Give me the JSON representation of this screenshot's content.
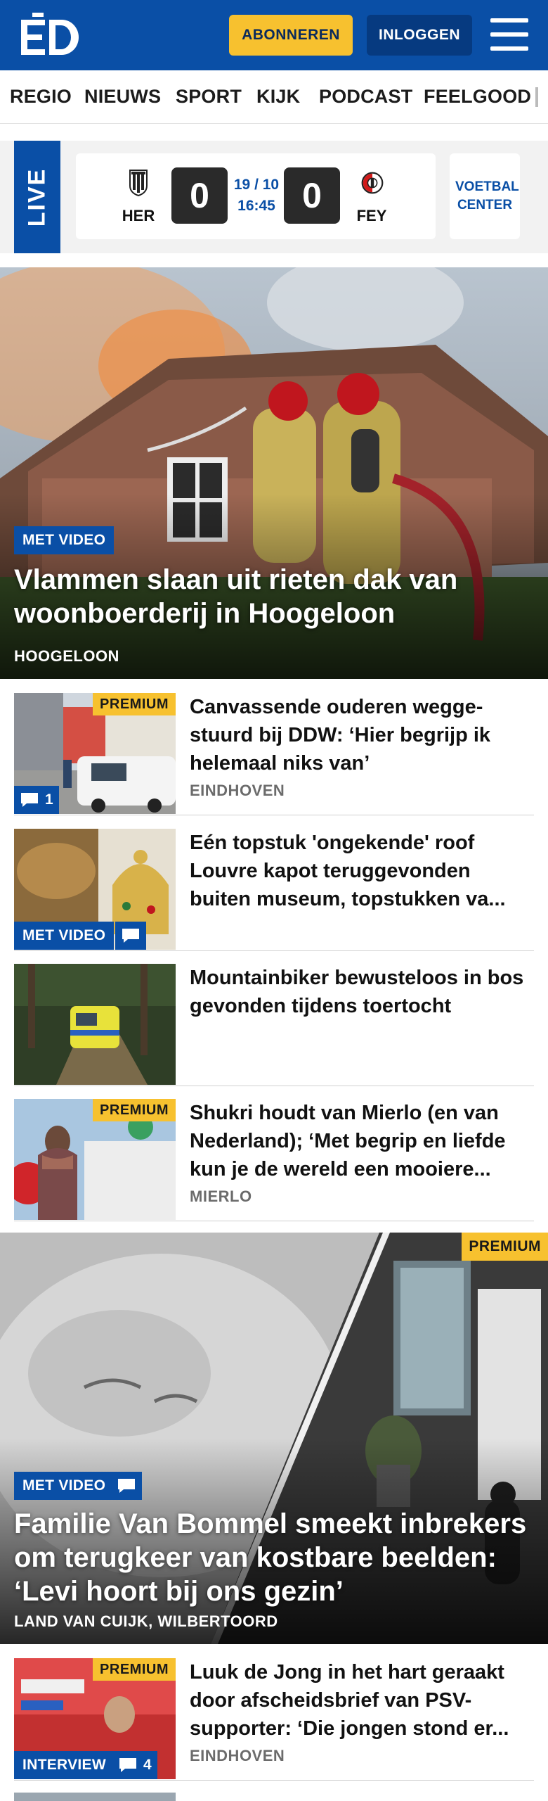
{
  "header": {
    "logo_text": "ED",
    "subscribe_label": "ABONNEREN",
    "login_label": "INLOGGEN",
    "colors": {
      "brand": "#0a4fa6",
      "accent": "#f7c12f",
      "dark": "#063a80"
    }
  },
  "nav": {
    "items": [
      "REGIO",
      "NIEUWS",
      "SPORT",
      "KIJK",
      "PODCAST",
      "FEELGOOD"
    ]
  },
  "live": {
    "label": "LIVE",
    "match": {
      "home": {
        "name": "HER",
        "score": "0"
      },
      "away": {
        "name": "FEY",
        "score": "0"
      },
      "date": "19 / 10",
      "time": "16:45"
    },
    "voetbal_center": "VOETBAL CENTER"
  },
  "hero1": {
    "badge": "MET VIDEO",
    "title": "Vlammen slaan uit rieten dak van woonboerderij in Hoogeloon",
    "location": "HOOGELOON"
  },
  "articles": [
    {
      "premium": "PREMIUM",
      "title": "Canvassende ouderen wegge­stuurd bij DDW: ‘Hier begrijp ik helemaal niks van’",
      "location": "EINDHOVEN",
      "comments": "1"
    },
    {
      "badge": "MET VIDEO",
      "title": "Eén topstuk 'ongekende' roof Louvre kapot teruggevonden buiten museum, topstukken va..."
    },
    {
      "title": "Mountainbiker bewusteloos in bos gevonden tijdens toertocht"
    },
    {
      "premium": "PREMIUM",
      "title": "Shukri houdt van Mierlo (en van Nederland); ‘Met begrip en liefde kun je de wereld een mooiere...",
      "location": "MIERLO"
    }
  ],
  "hero2": {
    "premium": "PREMIUM",
    "badge": "MET VIDEO",
    "title": "Familie Van Bommel smeekt inbrekers om terugkeer van kostbare beelden: ‘Levi hoort bij ons gezin’",
    "location": "LAND VAN CUIJK, WILBERTOORD"
  },
  "article_last": {
    "premium": "PREMIUM",
    "badge": "INTERVIEW",
    "comments": "4",
    "title": "Luuk de Jong in het hart geraakt door afscheidsbrief van PSV-supporter: ‘Die jongen stond er...",
    "location": "EINDHOVEN"
  }
}
